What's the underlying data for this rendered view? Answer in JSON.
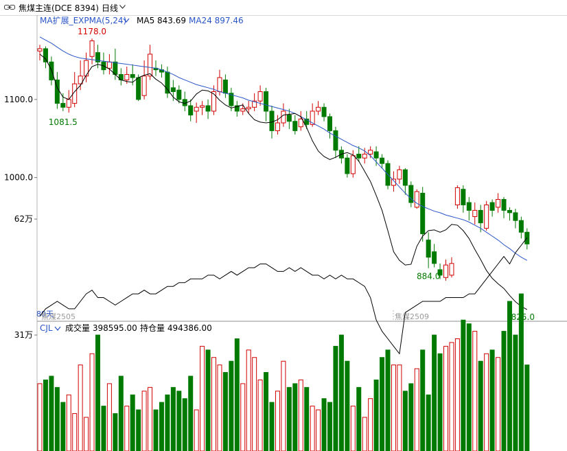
{
  "titlebar": {
    "instrument": "焦煤主连(DCE 8394)",
    "period": "日线",
    "link_icon": "link-icon",
    "dropdown_icon": "chevron-down-icon"
  },
  "price_panel": {
    "indicator_label": "MA扩展_EXPMA(5,24)",
    "ma5_label": "MA5 843.69",
    "ma24_label": "MA24 897.46",
    "y_ticks": [
      {
        "label": "1100.0",
        "value": 1100
      },
      {
        "label": "1000.0",
        "value": 1000
      }
    ],
    "annotations": {
      "high": "1178.0",
      "low_left": "1081.5",
      "low_mid": "884.0",
      "last_low": "825.0"
    },
    "bottom_left": "89天",
    "contract_left": "焦煤2505",
    "contract_right": "焦煤2509"
  },
  "volume_panel": {
    "indicator_label": "CJL",
    "volume_label": "成交量 398595.00",
    "oi_label": "持仓量 494386.00",
    "y_ticks": [
      {
        "label": "62万",
        "value": 62
      },
      {
        "label": "31万",
        "value": 31
      }
    ]
  },
  "colors": {
    "up": "#d20000",
    "down": "#007a00",
    "ma5": "#000000",
    "ma24": "#2a55c8",
    "axis": "#b5b5b5"
  },
  "chart_data": [
    {
      "type": "candlestick",
      "title": "焦煤主连(DCE 8394)",
      "ylim": [
        816,
        1208
      ],
      "series": [
        {
          "name": "MA5",
          "values": [
            1158,
            1152,
            1138,
            1115,
            1103,
            1100,
            1110,
            1118,
            1131,
            1142,
            1145,
            1143,
            1139,
            1132,
            1125,
            1123,
            1122,
            1128,
            1131,
            1133,
            1126,
            1121,
            1113,
            1103,
            1097,
            1095,
            1098,
            1107,
            1112,
            1111,
            1107,
            1099,
            1093,
            1089,
            1091,
            1093,
            1082,
            1074,
            1071,
            1070,
            1071,
            1074,
            1080,
            1081,
            1082,
            1078,
            1064,
            1047,
            1034,
            1027,
            1023,
            1026,
            1030,
            1032,
            1029,
            1021,
            1008,
            995,
            977,
            958,
            932,
            905,
            894,
            888,
            889,
            912,
            925,
            932,
            933,
            930,
            933,
            940,
            939,
            932,
            922,
            908,
            895,
            881,
            871,
            864,
            858,
            849,
            841,
            835,
            831
          ]
        },
        {
          "name": "MA24",
          "values": [
            1180,
            1176,
            1172,
            1167,
            1162,
            1158,
            1155,
            1153,
            1152,
            1151,
            1150,
            1149,
            1148,
            1147,
            1146,
            1145,
            1144,
            1143,
            1142,
            1141,
            1140,
            1138,
            1135,
            1132,
            1128,
            1125,
            1122,
            1119,
            1117,
            1115,
            1113,
            1110,
            1108,
            1106,
            1104,
            1102,
            1099,
            1097,
            1095,
            1093,
            1091,
            1089,
            1087,
            1085,
            1082,
            1078,
            1074,
            1070,
            1066,
            1062,
            1057,
            1053,
            1049,
            1045,
            1041,
            1038,
            1034,
            1028,
            1020,
            1012,
            1004,
            996,
            988,
            980,
            973,
            967,
            963,
            960,
            957,
            955,
            952,
            950,
            948,
            946,
            943,
            939,
            935,
            930,
            925,
            920,
            914,
            909,
            903,
            898,
            894
          ]
        },
        {
          "name": "成交量",
          "unit": "万",
          "values": [
            18,
            19,
            20,
            17,
            13,
            15,
            10,
            23,
            9,
            26,
            31,
            12,
            18,
            10,
            20,
            12,
            15,
            11,
            16,
            17,
            11,
            13,
            15,
            17,
            16,
            14,
            20,
            11,
            28,
            27,
            25,
            23,
            21,
            24,
            30,
            18,
            27,
            25,
            19,
            21,
            13,
            16,
            24,
            17,
            18,
            19,
            17,
            12,
            11,
            14,
            13,
            28,
            31,
            24,
            12,
            17,
            9,
            14,
            19,
            25,
            27,
            23,
            23,
            16,
            18,
            22,
            27,
            15,
            31,
            26,
            28,
            29,
            30,
            35,
            34,
            32,
            24,
            26,
            27,
            25,
            32,
            40,
            31,
            42,
            23
          ]
        },
        {
          "name": "持仓量",
          "unit": "万",
          "values": [
            36,
            38,
            39,
            40,
            39,
            38,
            38,
            40,
            42,
            43,
            41,
            41,
            40,
            39,
            40,
            41,
            42,
            42,
            43,
            42,
            42,
            43,
            44,
            44,
            45,
            45,
            46,
            46,
            46,
            47,
            47,
            46,
            47,
            48,
            47,
            48,
            49,
            49,
            50,
            50,
            49,
            48,
            48,
            49,
            48,
            49,
            48,
            47,
            47,
            46,
            47,
            46,
            47,
            46,
            46,
            45,
            44,
            41,
            35,
            32,
            30,
            28,
            26,
            37,
            38,
            39,
            40,
            40,
            40,
            40,
            41,
            41,
            41,
            41,
            42,
            42,
            44,
            46,
            48,
            50,
            52,
            50,
            53,
            55,
            57
          ]
        }
      ],
      "candles": [
        [
          1162,
          1165,
          1170,
          1150
        ],
        [
          1165,
          1148,
          1168,
          1140
        ],
        [
          1148,
          1125,
          1155,
          1118
        ],
        [
          1125,
          1095,
          1135,
          1088
        ],
        [
          1095,
          1090,
          1108,
          1085
        ],
        [
          1090,
          1100,
          1112,
          1083
        ],
        [
          1095,
          1120,
          1135,
          1090
        ],
        [
          1120,
          1130,
          1150,
          1112
        ],
        [
          1130,
          1150,
          1160,
          1122
        ],
        [
          1155,
          1175,
          1178,
          1145
        ],
        [
          1160,
          1148,
          1170,
          1140
        ],
        [
          1148,
          1138,
          1160,
          1132
        ],
        [
          1140,
          1148,
          1158,
          1132
        ],
        [
          1148,
          1132,
          1165,
          1125
        ],
        [
          1132,
          1125,
          1140,
          1118
        ],
        [
          1125,
          1132,
          1142,
          1120
        ],
        [
          1132,
          1128,
          1145,
          1118
        ],
        [
          1128,
          1100,
          1132,
          1098
        ],
        [
          1105,
          1130,
          1150,
          1100
        ],
        [
          1130,
          1158,
          1170,
          1125
        ],
        [
          1140,
          1138,
          1150,
          1130
        ],
        [
          1138,
          1135,
          1145,
          1128
        ],
        [
          1135,
          1108,
          1142,
          1102
        ],
        [
          1115,
          1110,
          1125,
          1098
        ],
        [
          1112,
          1100,
          1118,
          1095
        ],
        [
          1100,
          1092,
          1110,
          1085
        ],
        [
          1092,
          1080,
          1100,
          1072
        ],
        [
          1085,
          1090,
          1096,
          1070
        ],
        [
          1090,
          1092,
          1098,
          1080
        ],
        [
          1092,
          1085,
          1100,
          1075
        ],
        [
          1085,
          1110,
          1118,
          1080
        ],
        [
          1110,
          1128,
          1138,
          1105
        ],
        [
          1125,
          1108,
          1132,
          1102
        ],
        [
          1108,
          1092,
          1115,
          1085
        ],
        [
          1092,
          1085,
          1098,
          1078
        ],
        [
          1085,
          1088,
          1095,
          1080
        ],
        [
          1088,
          1090,
          1098,
          1082
        ],
        [
          1090,
          1098,
          1108,
          1085
        ],
        [
          1098,
          1110,
          1118,
          1092
        ],
        [
          1110,
          1085,
          1115,
          1072
        ],
        [
          1085,
          1060,
          1092,
          1050
        ],
        [
          1060,
          1070,
          1080,
          1055
        ],
        [
          1070,
          1085,
          1095,
          1065
        ],
        [
          1080,
          1072,
          1088,
          1062
        ],
        [
          1072,
          1060,
          1080,
          1055
        ],
        [
          1065,
          1075,
          1085,
          1060
        ],
        [
          1075,
          1068,
          1085,
          1062
        ],
        [
          1068,
          1085,
          1095,
          1065
        ],
        [
          1085,
          1090,
          1098,
          1080
        ],
        [
          1090,
          1078,
          1095,
          1072
        ],
        [
          1078,
          1060,
          1082,
          1050
        ],
        [
          1060,
          1035,
          1065,
          1025
        ],
        [
          1035,
          1025,
          1040,
          1018
        ],
        [
          1025,
          1005,
          1030,
          1000
        ],
        [
          1005,
          1028,
          1035,
          1000
        ],
        [
          1030,
          1025,
          1040,
          1020
        ],
        [
          1025,
          1030,
          1038,
          1018
        ],
        [
          1030,
          1035,
          1040,
          1025
        ],
        [
          1033,
          1025,
          1040,
          1015
        ],
        [
          1025,
          1018,
          1030,
          1012
        ],
        [
          1018,
          990,
          1022,
          985
        ],
        [
          990,
          998,
          1008,
          982
        ],
        [
          998,
          1010,
          1015,
          992
        ],
        [
          1010,
          990,
          1012,
          978
        ],
        [
          990,
          968,
          995,
          962
        ],
        [
          962,
          982,
          985,
          960
        ],
        [
          980,
          928,
          988,
          918
        ],
        [
          920,
          898,
          930,
          884
        ],
        [
          905,
          890,
          915,
          885
        ],
        [
          882,
          875,
          890,
          870
        ],
        [
          872,
          888,
          895,
          868
        ],
        [
          875,
          890,
          898,
          872
        ],
        [
          965,
          987,
          990,
          960
        ],
        [
          985,
          965,
          990,
          955
        ],
        [
          968,
          958,
          975,
          945
        ],
        [
          950,
          958,
          968,
          940
        ],
        [
          958,
          942,
          965,
          930
        ],
        [
          935,
          965,
          970,
          932
        ],
        [
          968,
          958,
          972,
          950
        ],
        [
          962,
          972,
          980,
          955
        ],
        [
          972,
          958,
          975,
          948
        ],
        [
          958,
          955,
          962,
          945
        ],
        [
          955,
          945,
          960,
          935
        ],
        [
          945,
          930,
          950,
          922
        ],
        [
          930,
          915,
          935,
          908
        ]
      ]
    }
  ]
}
